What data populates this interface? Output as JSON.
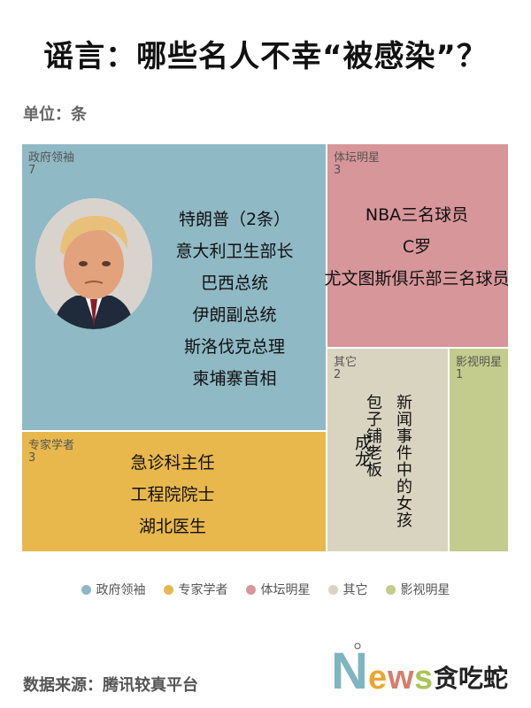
{
  "title": "谣言：哪些名人不幸“被感染”？",
  "unit": "单位：条",
  "source": "数据来源：腾讯较真平台",
  "logo": {
    "letters": [
      "N",
      "e",
      "w",
      "s"
    ],
    "text": "贪吃蛇"
  },
  "colors": {
    "政府领袖": "#8fb9c4",
    "专家学者": "#e8b84d",
    "体坛明星": "#d7969a",
    "其它": "#d8d4c0",
    "影视明星": "#c3cc8c",
    "logo_N": "#7fb5c0",
    "logo_e": "#e8a830",
    "logo_w": "#d97c6c",
    "logo_s": "#a9c45a",
    "logo_text": "#222222"
  },
  "chart_data": {
    "type": "treemap",
    "title": "谣言：哪些名人不幸“被感染”？",
    "unit": "单位：条",
    "categories": [
      "政府领袖",
      "专家学者",
      "体坛明星",
      "其它",
      "影视明星"
    ],
    "values": [
      7,
      3,
      3,
      2,
      1
    ],
    "items": {
      "政府领袖": [
        "特朗普（2条）",
        "意大利卫生部长",
        "巴西总统",
        "伊朗副总统",
        "斯洛伐克总理",
        "柬埔寨首相"
      ],
      "专家学者": [
        "急诊科主任",
        "工程院院士",
        "湖北医生"
      ],
      "体坛明星": [
        "NBA三名球员",
        "C罗",
        "尤文图斯俱乐部三名球员"
      ],
      "其它": [
        "新闻事件中的女孩",
        "包子铺老板"
      ],
      "影视明星": [
        "成龙"
      ]
    },
    "legend": [
      "政府领袖",
      "专家学者",
      "体坛明星",
      "其它",
      "影视明星"
    ],
    "legend_position": "bottom"
  }
}
